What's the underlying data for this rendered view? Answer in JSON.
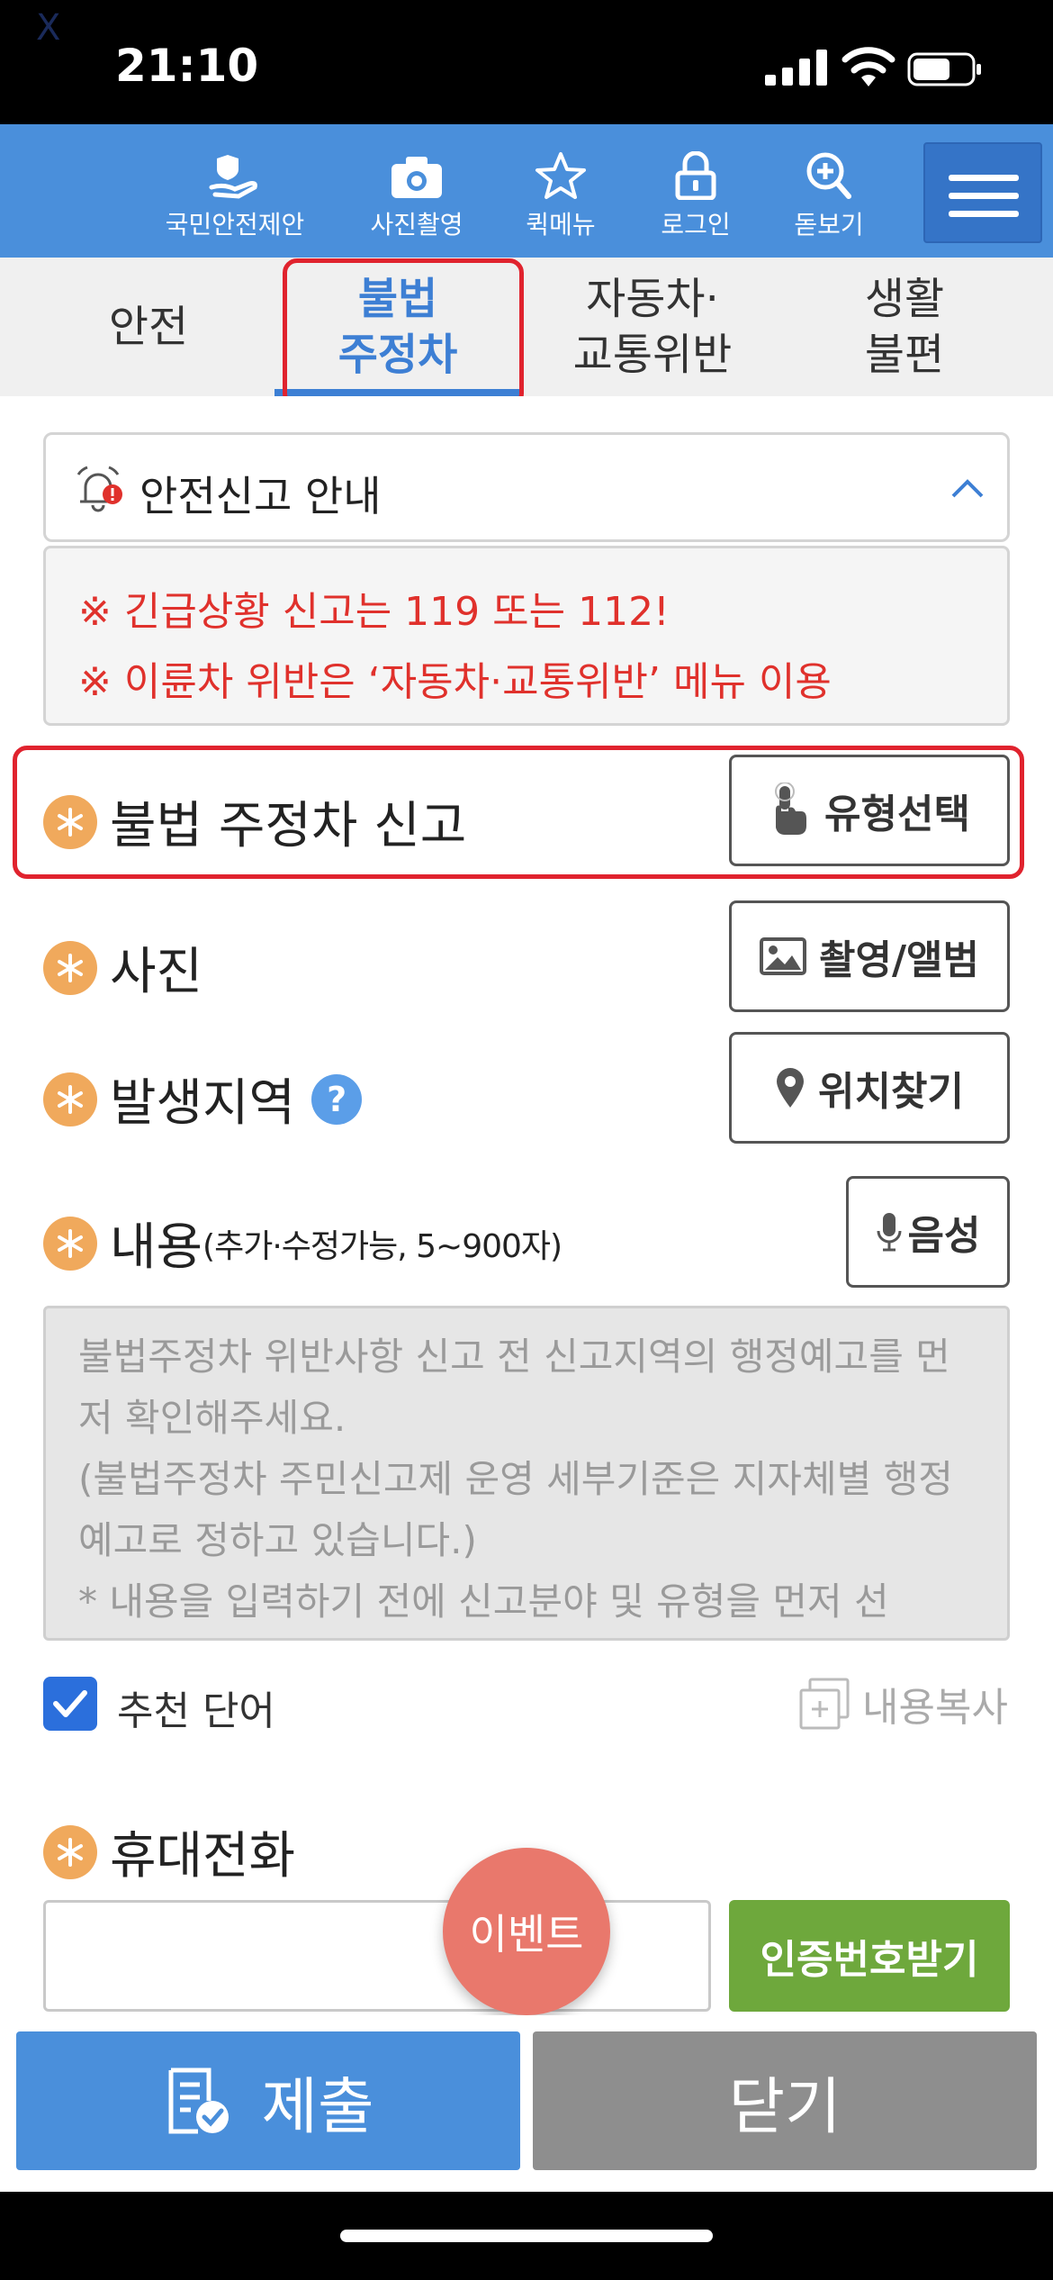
{
  "status_bar": {
    "corner_mark": "X",
    "time": "21:10"
  },
  "top_nav": {
    "items": [
      {
        "label": "국민안전제안",
        "icon": "hand-shield-icon"
      },
      {
        "label": "사진촬영",
        "icon": "camera-icon"
      },
      {
        "label": "퀵메뉴",
        "icon": "star-icon"
      },
      {
        "label": "로그인",
        "icon": "lock-icon"
      },
      {
        "label": "돋보기",
        "icon": "magnifier-plus-icon"
      }
    ],
    "menu_icon": "hamburger-icon",
    "bg_color": "#4a8fdb"
  },
  "tabs": [
    {
      "label": "안전",
      "active": false
    },
    {
      "label": "불법\n주정차",
      "active": true
    },
    {
      "label": "자동차·\n교통위반",
      "active": false
    },
    {
      "label": "생활\n불편",
      "active": false
    }
  ],
  "notice": {
    "title": "안전신고 안내",
    "lines": [
      "※ 긴급상황 신고는 119 또는 112!",
      "※ 이륜차 위반은 ‘자동차·교통위반’ 메뉴 이용"
    ]
  },
  "form": {
    "report_type": {
      "label": "불법 주정차 신고",
      "button": "유형선택"
    },
    "photo": {
      "label": "사진",
      "button": "촬영/앨범"
    },
    "location": {
      "label": "발생지역",
      "help": "?",
      "button": "위치찾기"
    },
    "content": {
      "label": "내용",
      "sub": "(추가·수정가능, 5~900자)",
      "button": "음성",
      "placeholder": "불법주정차 위반사항 신고 전 신고지역의 행정예고를 먼저 확인해주세요.\n(불법주정차 주민신고제 운영 세부기준은 지자체별 행정예고로 정하고 있습니다.)\n* 내용을 입력하기 전에 신고분야 및 유형을 먼저 선"
    },
    "recommend": {
      "label": "추천 단어",
      "checked": true
    },
    "copy_label": "내용복사",
    "phone": {
      "label": "휴대전화",
      "value": "",
      "verify_button": "인증번호받기"
    }
  },
  "event_button": "이벤트",
  "bottom": {
    "submit": "제출",
    "close": "닫기"
  },
  "colors": {
    "accent": "#4a8fdb",
    "warning": "#e0312c",
    "required": "#f0a95c",
    "verify": "#6ea83c",
    "event": "#e9786c"
  }
}
